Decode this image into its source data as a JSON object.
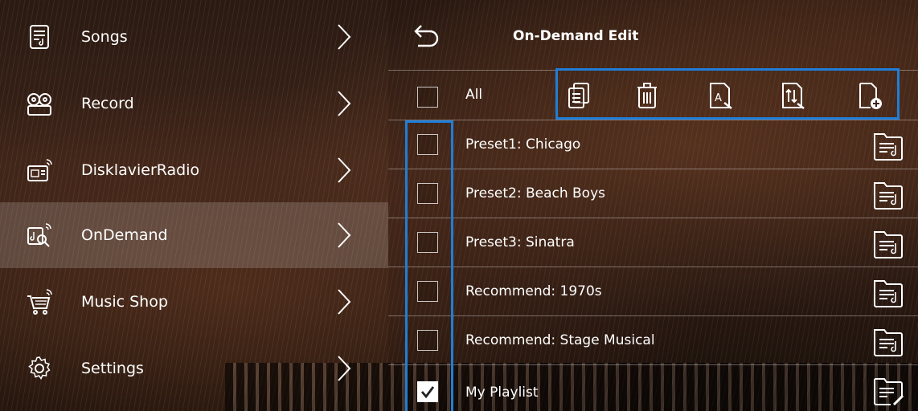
{
  "sidebar": {
    "items": [
      {
        "label": "Songs",
        "icon": "songs-icon"
      },
      {
        "label": "Record",
        "icon": "record-reel-icon"
      },
      {
        "label": "DisklavierRadio",
        "icon": "radio-icon"
      },
      {
        "label": "OnDemand",
        "icon": "ondemand-search-icon"
      },
      {
        "label": "Music Shop",
        "icon": "shopping-cart-icon"
      },
      {
        "label": "Settings",
        "icon": "gear-icon"
      }
    ]
  },
  "header": {
    "title": "On-Demand Edit"
  },
  "all_row": {
    "label": "All"
  },
  "toolbar": {
    "icons": [
      "copy-icon",
      "trash-icon",
      "rename-icon",
      "sort-icon",
      "new-file-icon"
    ]
  },
  "list": {
    "rows": [
      {
        "label": "Preset1: Chicago",
        "checked": false
      },
      {
        "label": "Preset2: Beach Boys",
        "checked": false
      },
      {
        "label": "Preset3: Sinatra",
        "checked": false
      },
      {
        "label": "Recommend: 1970s",
        "checked": false
      },
      {
        "label": "Recommend: Stage Musical",
        "checked": false
      },
      {
        "label": "My Playlist",
        "checked": true
      }
    ]
  },
  "colors": {
    "highlight": "#1f7ed8",
    "text": "#ffffff"
  }
}
